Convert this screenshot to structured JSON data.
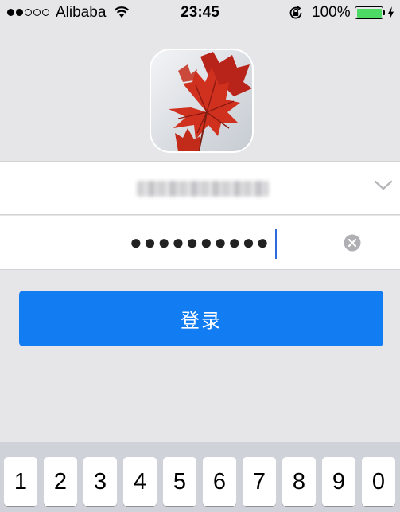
{
  "status_bar": {
    "signal_dots": [
      true,
      true,
      false,
      false,
      false
    ],
    "carrier": "Alibaba",
    "time": "23:45",
    "battery_percent": "100%",
    "battery_level": 1.0,
    "battery_color": "#4cd964",
    "icons": [
      "wifi-icon",
      "rotation-lock-icon",
      "battery-icon",
      "charging-bolt-icon"
    ]
  },
  "avatar": {
    "icon": "maple-leaf-avatar"
  },
  "account_field": {
    "dropdown_icon": "chevron-down-icon"
  },
  "password_field": {
    "value": "●●●●●●●●●●",
    "clear_icon": "clear-circle-icon"
  },
  "login_button": {
    "label": "登录",
    "color": "#127cf2"
  },
  "keyboard": {
    "keys": [
      "1",
      "2",
      "3",
      "4",
      "5",
      "6",
      "7",
      "8",
      "9",
      "0"
    ]
  }
}
